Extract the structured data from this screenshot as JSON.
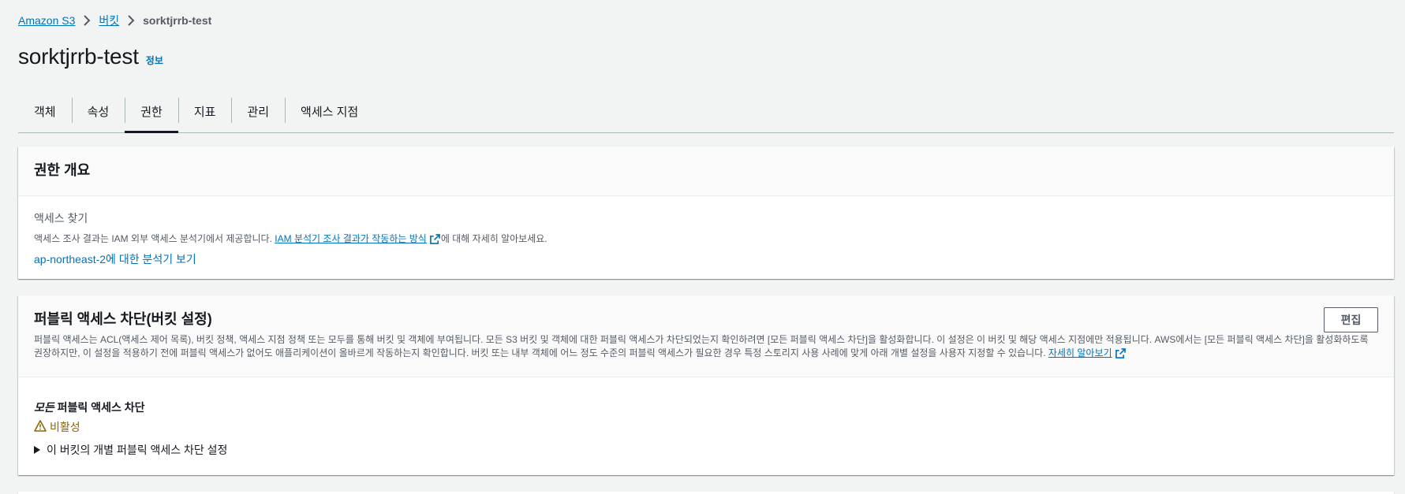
{
  "breadcrumb": {
    "items": [
      "Amazon S3",
      "버킷"
    ],
    "current": "sorktjrrb-test"
  },
  "page": {
    "title": "sorktjrrb-test",
    "info": "정보"
  },
  "tabs": [
    {
      "label": "객체"
    },
    {
      "label": "속성"
    },
    {
      "label": "권한"
    },
    {
      "label": "지표"
    },
    {
      "label": "관리"
    },
    {
      "label": "액세스 지점"
    }
  ],
  "permissions_overview": {
    "title": "권한 개요",
    "access_findings_label": "액세스 찾기",
    "desc_pre": "액세스 조사 결과는 IAM 외부 액세스 분석기에서 제공합니다.",
    "desc_link": "IAM 분석기 조사 결과가 작동하는 방식",
    "desc_post": "에 대해 자세히 알아보세요.",
    "analyzer_link": "ap-northeast-2에 대한 분석기 보기"
  },
  "block_public_access": {
    "title": "퍼블릭 액세스 차단(버킷 설정)",
    "edit_label": "편집",
    "description": "퍼블릭 액세스는 ACL(액세스 제어 목록), 버킷 정책, 액세스 지점 정책 또는 모두를 통해 버킷 및 객체에 부여됩니다. 모든 S3 버킷 및 객체에 대한 퍼블릭 액세스가 차단되었는지 확인하려면 [모든 퍼블릭 액세스 차단]을 활성화합니다. 이 설정은 이 버킷 및 해당 액세스 지점에만 적용됩니다. AWS에서는 [모든 퍼블릭 액세스 차단]을 활성화하도록 권장하지만, 이 설정을 적용하기 전에 퍼블릭 액세스가 없어도 애플리케이션이 올바르게 작동하는지 확인합니다. 버킷 또는 내부 객체에 어느 정도 수준의 퍼블릭 액세스가 필요한 경우 특정 스토리지 사용 사례에 맞게 아래 개별 설정을 사용자 지정할 수 있습니다.",
    "learn_more": "자세히 알아보기",
    "block_all_italic": "모든",
    "block_all_rest": " 퍼블릭 액세스 차단",
    "status": "비활성",
    "expander_label": "이 버킷의 개별 퍼블릭 액세스 차단 설정"
  },
  "icons": {
    "breadcrumb_separator": "chevron-right-icon",
    "external_link": "external-link-icon",
    "warning": "warning-icon",
    "expand": "caret-right-icon"
  },
  "colors": {
    "link": "#0073bb",
    "warning": "#8d6605",
    "text": "#16191f"
  }
}
